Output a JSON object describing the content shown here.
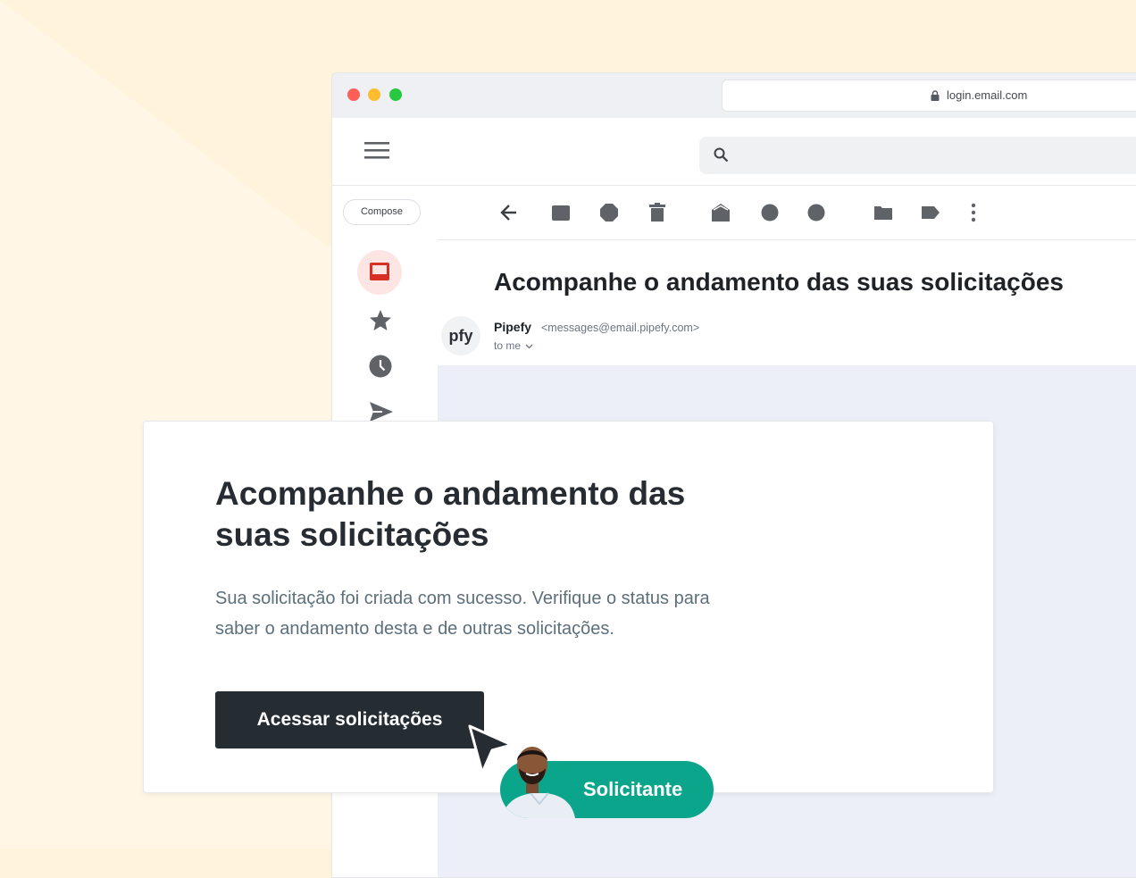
{
  "browser": {
    "url": "login.email.com"
  },
  "mail": {
    "compose_label": "Compose",
    "subject": "Acompanhe o andamento das suas solicitações",
    "sender_avatar": "pfy",
    "sender_name": "Pipefy",
    "sender_email": "<messages@email.pipefy.com>",
    "recipient": "to me"
  },
  "card": {
    "title": "Acompanhe o andamento das suas solicitações",
    "body": "Sua solicitação foi criada com sucesso. Verifique o status para saber o andamento desta e de outras solicitações.",
    "button_label": "Acessar solicitações"
  },
  "persona": {
    "label": "Solicitante"
  },
  "icons": {
    "nav": [
      "inbox-icon",
      "star-icon",
      "clock-icon",
      "send-icon"
    ],
    "toolbar": [
      "back-arrow-icon",
      "archive-icon",
      "report-icon",
      "delete-icon",
      "mark-unread-icon",
      "snooze-icon",
      "task-icon",
      "move-to-folder-icon",
      "label-icon",
      "more-vert-icon"
    ]
  },
  "colors": {
    "background": "#fff3dc",
    "accent": "#0aa58b",
    "button": "#252d33",
    "inbox_highlight": "#fde5e4",
    "inbox_icon": "#d93025"
  }
}
